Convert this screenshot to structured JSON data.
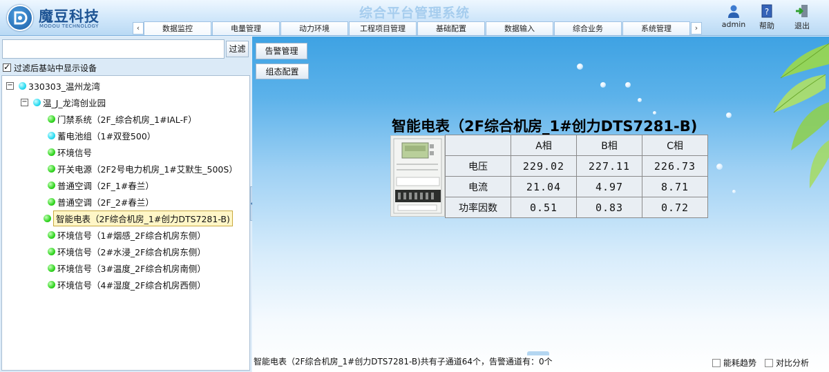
{
  "header": {
    "brand": "魔豆科技",
    "brand_sub": "MODOU TECHNOLOGY",
    "system_title": "综合平台管理系统",
    "tab_prev": "‹",
    "tab_next": "›",
    "tabs": [
      {
        "label": "数据监控",
        "active": true
      },
      {
        "label": "电量管理"
      },
      {
        "label": "动力环境"
      },
      {
        "label": "工程项目管理"
      },
      {
        "label": "基础配置"
      },
      {
        "label": "数据输入"
      },
      {
        "label": "综合业务"
      },
      {
        "label": "系统管理"
      }
    ],
    "user_label": "admin",
    "help_label": "帮助",
    "logout_label": "退出"
  },
  "left": {
    "filter_placeholder": "",
    "filter_button": "过滤",
    "alarm_button": "告警管理",
    "config_button": "组态配置",
    "show_devices_label": "过滤后基站中显示设备",
    "tree": {
      "root": "330303_温州龙湾",
      "site": "温_J_龙湾创业园",
      "devices": [
        {
          "label": "门禁系统（2F_综合机房_1#IAL-F）",
          "dot": "green"
        },
        {
          "label": "蓄电池组（1#双登500）",
          "dot": "cyan"
        },
        {
          "label": "环境信号",
          "dot": "green"
        },
        {
          "label": "开关电源（2F2号电力机房_1#艾默生_500S）",
          "dot": "green"
        },
        {
          "label": "普通空调（2F_1#春兰）",
          "dot": "green"
        },
        {
          "label": "普通空调（2F_2#春兰）",
          "dot": "green"
        },
        {
          "label": "智能电表（2F综合机房_1#创力DTS7281-B)",
          "dot": "green",
          "selected": true
        },
        {
          "label": "环境信号（1#烟感_2F综合机房东侧）",
          "dot": "green"
        },
        {
          "label": "环境信号（2#水浸_2F综合机房东侧）",
          "dot": "green"
        },
        {
          "label": "环境信号（3#温度_2F综合机房南侧）",
          "dot": "green"
        },
        {
          "label": "环境信号（4#湿度_2F综合机房西侧）",
          "dot": "green"
        }
      ]
    }
  },
  "main": {
    "device_title": "智能电表（2F综合机房_1#创力DTS7281-B)",
    "table": {
      "columns": [
        "",
        "A相",
        "B相",
        "C相"
      ],
      "rows": [
        {
          "label": "电压",
          "values": [
            "229.02",
            "227.11",
            "226.73"
          ]
        },
        {
          "label": "电流",
          "values": [
            "21.04",
            "4.97",
            "8.71"
          ]
        },
        {
          "label": "功率因数",
          "values": [
            "0.51",
            "0.83",
            "0.72"
          ]
        }
      ]
    },
    "status_text": "智能电表（2F综合机房_1#创力DTS7281-B)共有子通道64个，告警通道有：0个",
    "energy_trend_label": "能耗趋势",
    "compare_label": "对比分析"
  }
}
